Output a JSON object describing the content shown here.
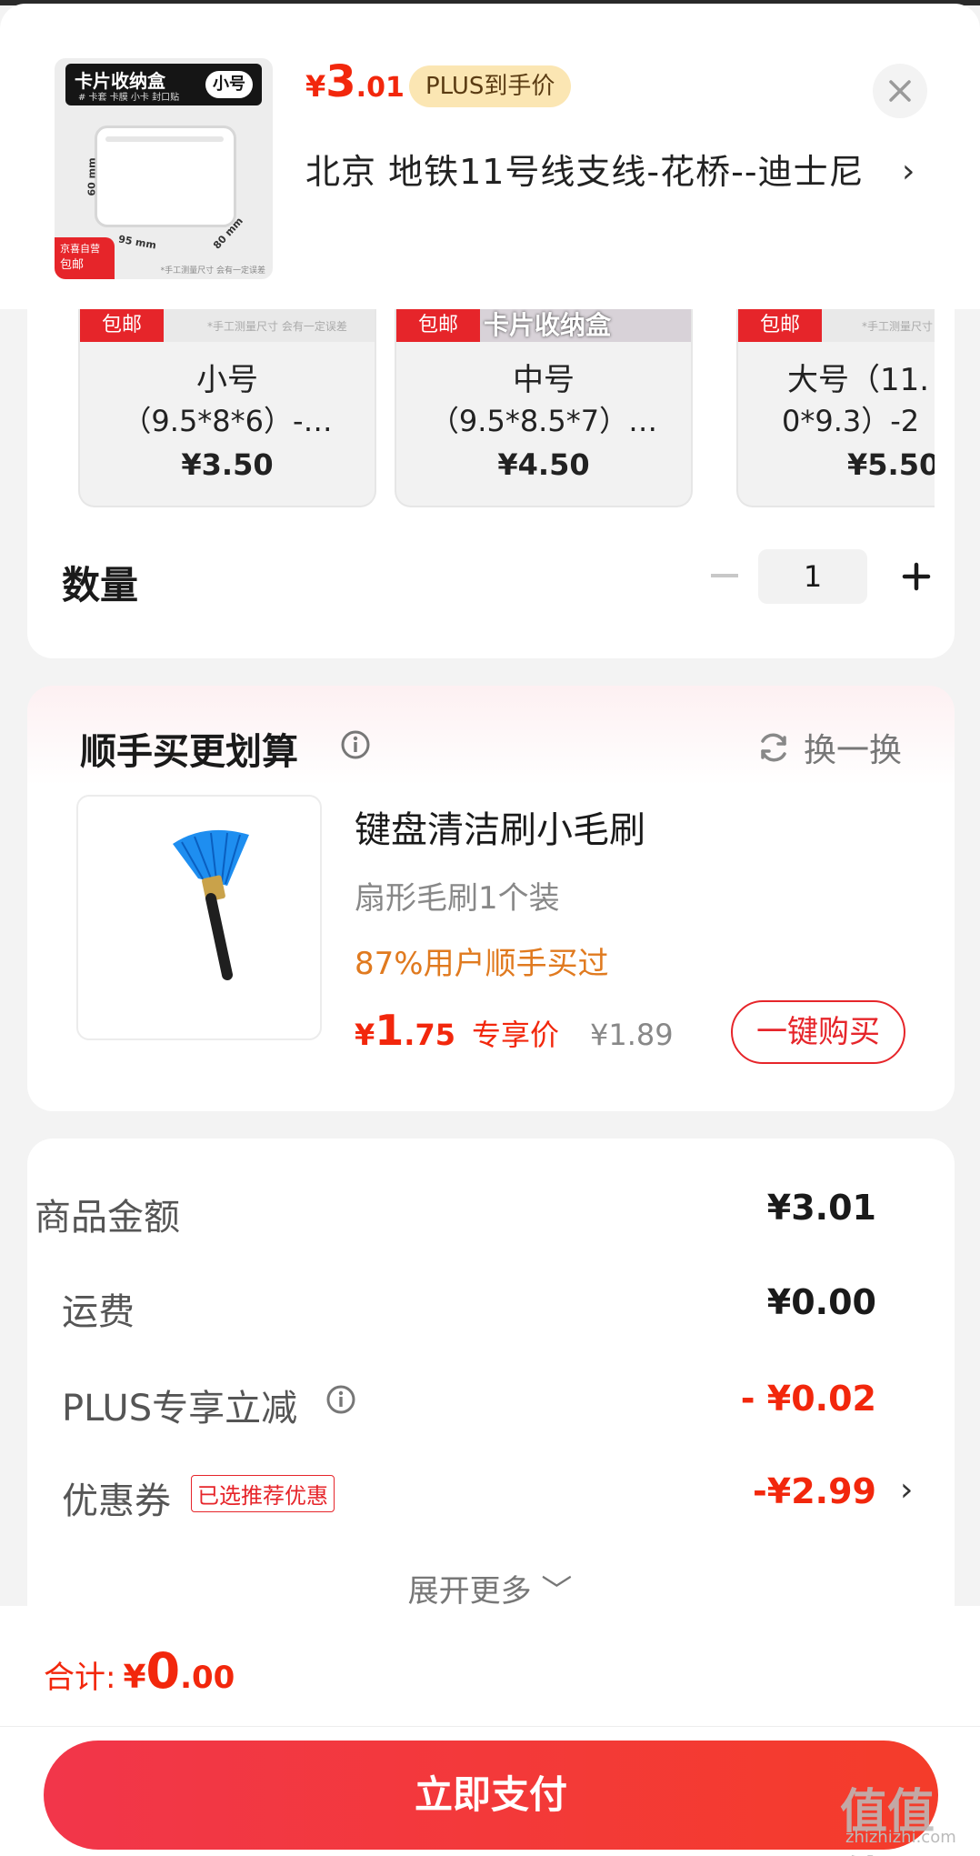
{
  "header": {
    "thumbnail": {
      "title": "卡片收纳盒",
      "size_tag": "小号",
      "subtitle": "# 卡套 卡膜 小卡 封口贴",
      "dims": [
        "60 mm",
        "95 mm",
        "80 mm"
      ],
      "badge_line1": "京喜自营",
      "badge_line2": "包邮",
      "note": "*手工测量尺寸 会有一定误差"
    },
    "price": {
      "yen": "¥",
      "int": "3",
      "dec": ".01"
    },
    "plus_tag": "PLUS到手价",
    "close_icon": "close-icon",
    "address": "北京  地铁11号线支线-花桥--迪士尼",
    "address_chevron": "›"
  },
  "variants": [
    {
      "badge": "包邮",
      "strip_text": "*手工测量尺寸 会有一定误差",
      "line1": "小号",
      "line2": "（9.5*8*6）-…",
      "price": "¥3.50"
    },
    {
      "badge": "包邮",
      "strip_text": "卡片收纳盒",
      "line1": "中号",
      "line2": "（9.5*8.5*7）…",
      "price": "¥4.50"
    },
    {
      "badge": "包邮",
      "strip_text": "*手工测量尺寸",
      "line1": "大号（11.",
      "line2": "0*9.3）-2",
      "price": "¥5.50"
    }
  ],
  "quantity": {
    "label": "数量",
    "value": "1"
  },
  "addon": {
    "title": "顺手买更划算",
    "swap_label": "换一换",
    "name": "键盘清洁刷小毛刷",
    "spec": "扇形毛刷1个装",
    "social": "87%用户顺手买过",
    "price": {
      "yen": "¥",
      "int": "1",
      "dec": ".75"
    },
    "price_label": "专享价",
    "orig_price": "¥1.89",
    "buy_button": "一键购买"
  },
  "summary": {
    "rows": [
      {
        "label": "商品金额",
        "value": "¥3.01"
      },
      {
        "label": "运费",
        "value": "¥0.00"
      },
      {
        "label": "PLUS专享立减",
        "value": "- ¥0.02"
      },
      {
        "label": "优惠券",
        "value": "-¥2.99",
        "tag": "已选推荐优惠",
        "chevron": "›"
      }
    ],
    "expand": "展开更多 ﹀"
  },
  "footer": {
    "total_label": "合计:",
    "total_yen": "¥",
    "total_int": "0",
    "total_dec": ".00",
    "pay_button": "立即支付"
  },
  "watermark": {
    "logo": "值值值",
    "site": "zhizhizhi.com"
  },
  "colors": {
    "accent": "#f2270c",
    "brand_red": "#e6252a",
    "plus_gold": "#fbe6b3",
    "social_orange": "#e07a1f"
  }
}
